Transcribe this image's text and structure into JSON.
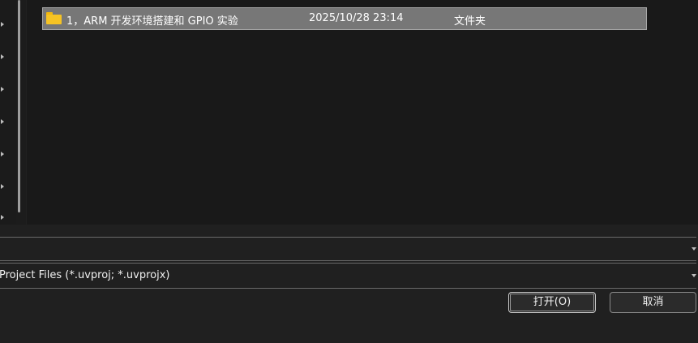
{
  "file_list": {
    "rows": [
      {
        "icon": "folder-icon",
        "name": "1，ARM 开发环境搭建和 GPIO 实验",
        "date_modified": "2025/10/28 23:14",
        "type": "文件夹"
      }
    ]
  },
  "file_name_input": {
    "value": ""
  },
  "file_type_filter": {
    "selected": "Project Files (*.uvproj; *.uvprojx)"
  },
  "buttons": {
    "open": "打开(O)",
    "cancel": "取消"
  },
  "colors": {
    "selection": "#777777",
    "folder": "#f6c324",
    "background": "#202020"
  }
}
